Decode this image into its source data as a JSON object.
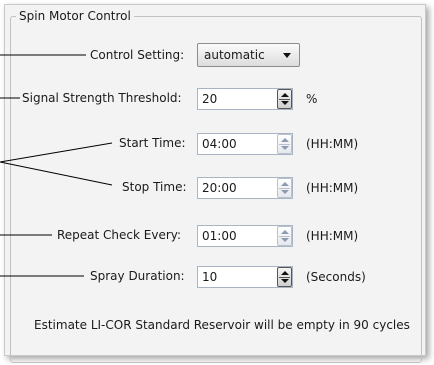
{
  "group": {
    "title": "Spin Motor Control"
  },
  "control_setting": {
    "label": "Control Setting:",
    "value": "automatic"
  },
  "signal_strength": {
    "label": "Signal Strength Threshold:",
    "value": "20",
    "unit": "%"
  },
  "start_time": {
    "label": "Start Time:",
    "value": "04:00",
    "unit": "(HH:MM)"
  },
  "stop_time": {
    "label": "Stop Time:",
    "value": "20:00",
    "unit": "(HH:MM)"
  },
  "repeat_check": {
    "label": "Repeat Check Every:",
    "value": "01:00",
    "unit": "(HH:MM)"
  },
  "spray_duration": {
    "label": "Spray Duration:",
    "value": "10",
    "unit": "(Seconds)"
  },
  "estimate_text": "Estimate LI-COR Standard Reservoir will be empty in 90 cycles"
}
